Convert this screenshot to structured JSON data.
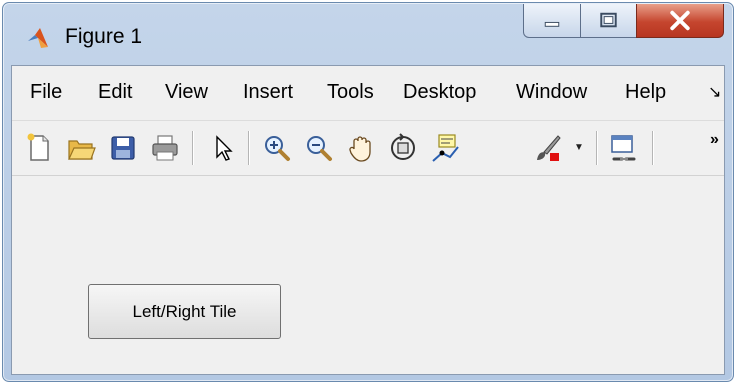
{
  "window": {
    "title": "Figure 1",
    "controls": {
      "minimize": "minimize-icon",
      "maximize": "maximize-icon",
      "close": "close-icon"
    }
  },
  "menu": {
    "items": [
      "File",
      "Edit",
      "View",
      "Insert",
      "Tools",
      "Desktop",
      "Window",
      "Help"
    ],
    "overflow_icon": "menu-overflow-icon"
  },
  "toolbar": {
    "tools": [
      "new-figure-icon",
      "open-file-icon",
      "save-icon",
      "print-icon",
      "edit-plot-icon",
      "zoom-in-icon",
      "zoom-out-icon",
      "pan-icon",
      "rotate-3d-icon",
      "data-cursor-icon",
      "brush-icon",
      "link-plot-icon"
    ],
    "overflow_icon": "toolbar-overflow-icon"
  },
  "content": {
    "button_label": "Left/Right Tile"
  },
  "colors": {
    "titlebar": "#c4d5ea",
    "client_background": "#f0f0f0",
    "close_button": "#c5452e"
  }
}
